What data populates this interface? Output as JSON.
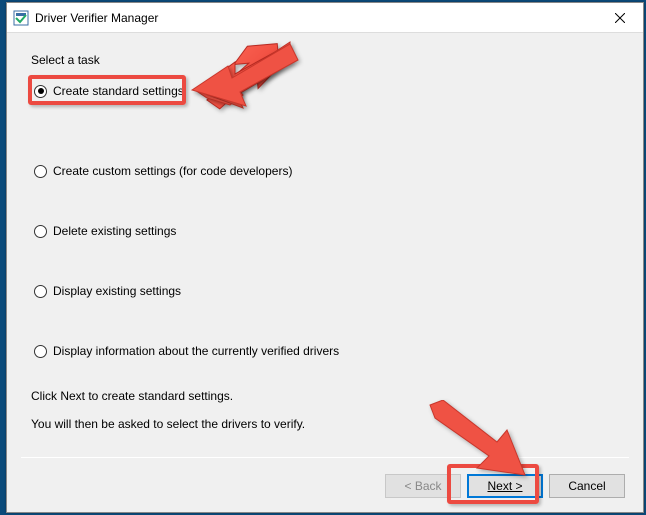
{
  "window": {
    "title": "Driver Verifier Manager"
  },
  "task": {
    "label": "Select a task",
    "options": [
      {
        "label": "Create standard settings",
        "selected": true
      },
      {
        "label": "Create custom settings (for code developers)",
        "selected": false
      },
      {
        "label": "Delete existing settings",
        "selected": false
      },
      {
        "label": "Display existing settings",
        "selected": false
      },
      {
        "label": "Display information about the currently verified drivers",
        "selected": false
      }
    ]
  },
  "info": {
    "line1": "Click Next to create standard settings.",
    "line2": "You will then be asked to select the drivers to verify."
  },
  "buttons": {
    "back": "< Back",
    "next": "Next >",
    "cancel": "Cancel"
  }
}
